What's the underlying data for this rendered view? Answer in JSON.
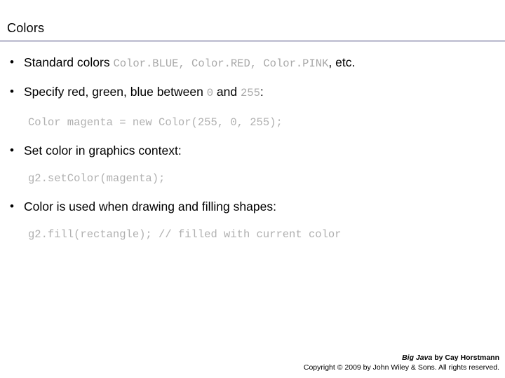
{
  "slide": {
    "title": "Colors",
    "bullets": [
      {
        "dot": "•",
        "pre": "Standard colors ",
        "code": "Color.BLUE, Color.RED, Color.PINK",
        "post": ", etc."
      },
      {
        "dot": "•",
        "pre": "Specify red, green, blue between ",
        "code": "0",
        "mid": " and ",
        "code2": "255",
        "post": ":"
      },
      {
        "dot": "•",
        "pre": "Set color in graphics context:"
      },
      {
        "dot": "•",
        "pre": "Color is used when drawing and filling shapes:"
      }
    ],
    "code_lines": [
      "Color magenta = new Color(255, 0, 255);",
      "g2.setColor(magenta);",
      "g2.fill(rectangle); // filled with current color"
    ]
  },
  "footer": {
    "book": "Big Java",
    "byline": " by Cay Horstmann",
    "copyright": "Copyright © 2009 by John Wiley & Sons.  All rights reserved."
  }
}
